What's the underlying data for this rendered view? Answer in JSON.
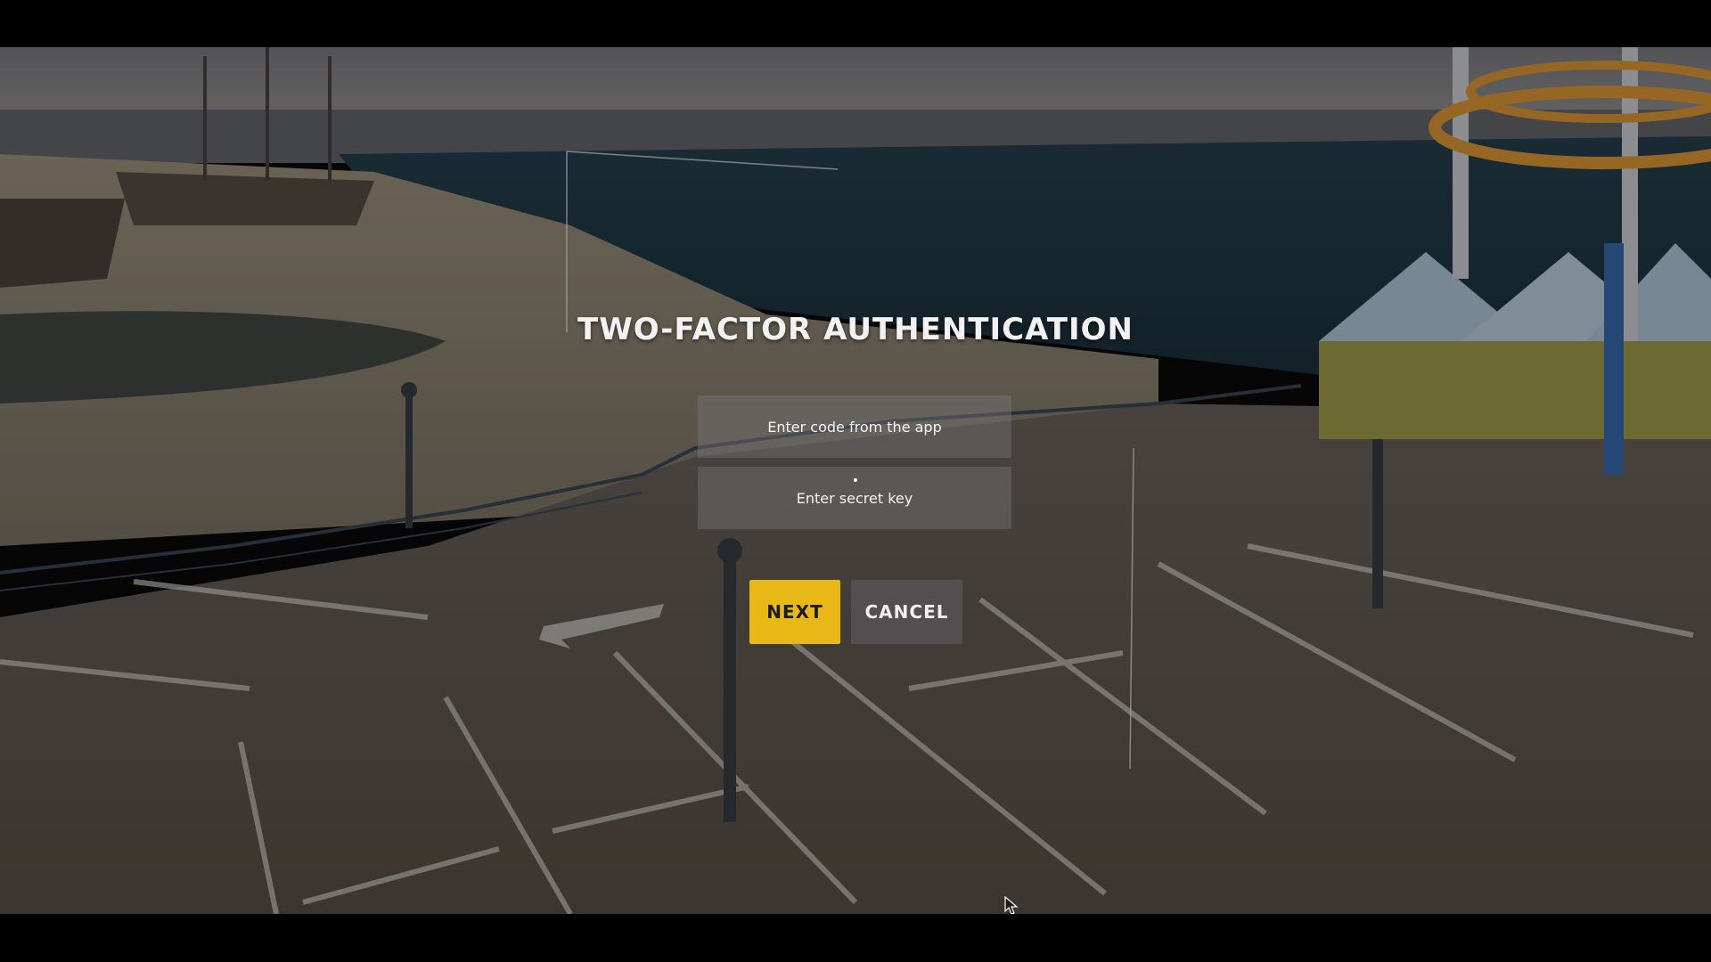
{
  "dialog": {
    "title": "TWO-FACTOR AUTHENTICATION",
    "code_field": {
      "placeholder": "Enter code from the app",
      "value": ""
    },
    "secret_field": {
      "placeholder": "Enter secret key",
      "value": ""
    },
    "next_label": "NEXT",
    "cancel_label": "CANCEL"
  },
  "colors": {
    "accent": "#e8b816",
    "button_secondary": "#5f5f64",
    "field_background": "#78787d"
  },
  "background": {
    "scene": "pier-and-beach",
    "icon": "mouse-cursor-icon"
  }
}
